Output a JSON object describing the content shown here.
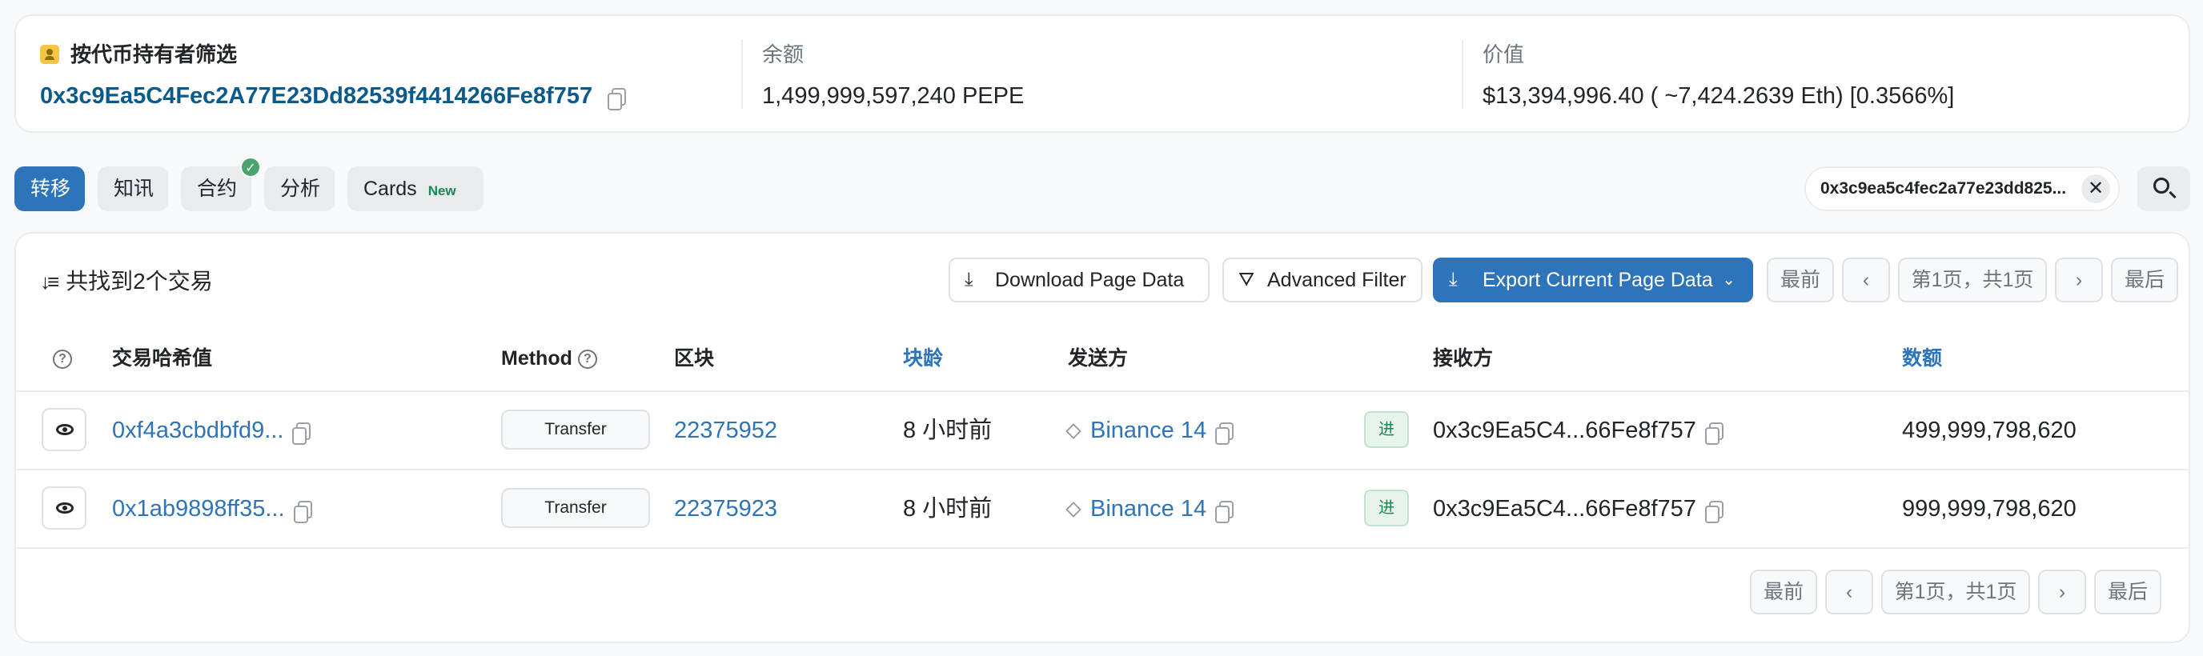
{
  "summary": {
    "filter_title": "按代币持有者筛选",
    "holder_address": "0x3c9Ea5C4Fec2A77E23Dd82539f4414266Fe8f757",
    "balance_label": "余额",
    "balance_value": "1,499,999,597,240 PEPE",
    "value_label": "价值",
    "value_value": "$13,394,996.40 ( ~7,424.2639 Eth) [0.3566%]"
  },
  "tabs": [
    {
      "label": "转移",
      "active": true
    },
    {
      "label": "知讯"
    },
    {
      "label": "合约",
      "verified_check": "✓"
    },
    {
      "label": "分析"
    },
    {
      "label": "Cards",
      "badge": "New"
    }
  ],
  "filter_chip": {
    "text": "0x3c9ea5c4fec2a77e23dd825...",
    "clear": "✕"
  },
  "toolbar": {
    "result_count": "共找到2个交易",
    "download_label": "Download Page Data",
    "advanced_filter_label": "Advanced Filter",
    "export_label": "Export Current Page Data",
    "pagination": {
      "first": "最前",
      "prev": "‹",
      "info": "第1页，共1页",
      "next": "›",
      "last": "最后"
    }
  },
  "table": {
    "columns": {
      "hash": "交易哈希值",
      "method": "Method",
      "block": "区块",
      "age": "块龄",
      "from": "发送方",
      "to": "接收方",
      "amount": "数额"
    },
    "rows": [
      {
        "hash": "0xf4a3cbdbfd9...",
        "method": "Transfer",
        "block": "22375952",
        "age": "8 小时前",
        "from": "Binance 14",
        "direction": "进",
        "to": "0x3c9Ea5C4...66Fe8f757",
        "amount": "499,999,798,620"
      },
      {
        "hash": "0x1ab9898ff35...",
        "method": "Transfer",
        "block": "22375923",
        "age": "8 小时前",
        "from": "Binance 14",
        "direction": "进",
        "to": "0x3c9Ea5C4...66Fe8f757",
        "amount": "999,999,798,620"
      }
    ]
  },
  "bottom_pagination": {
    "first": "最前",
    "prev": "‹",
    "info": "第1页，共1页",
    "next": "›",
    "last": "最后"
  },
  "colors": {
    "accent": "#2d74ba",
    "link": "#0b5a8c",
    "success": "#198754"
  }
}
